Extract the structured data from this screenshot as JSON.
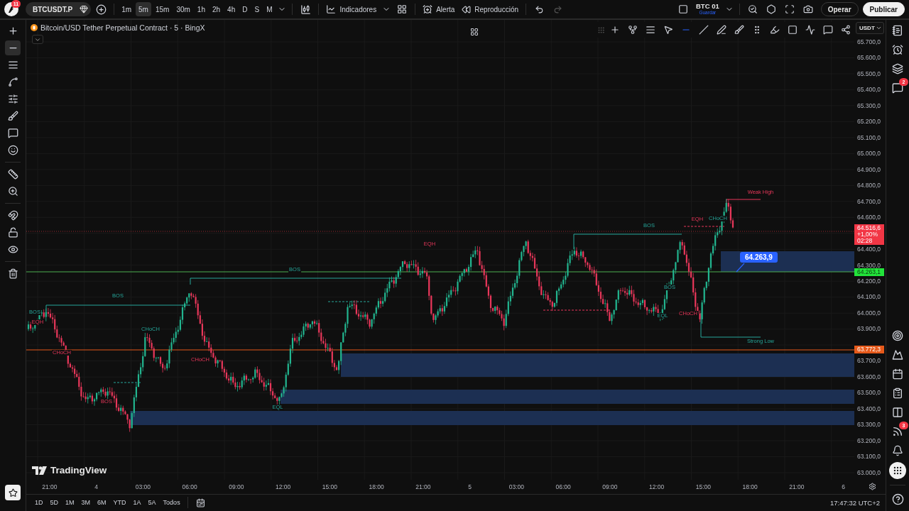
{
  "top_bar": {
    "logo_badge": "11",
    "symbol": "BTCUSDT.P",
    "intervals": [
      {
        "label": "1m",
        "selected": false
      },
      {
        "label": "5m",
        "selected": true
      },
      {
        "label": "15m",
        "selected": false
      },
      {
        "label": "30m",
        "selected": false
      },
      {
        "label": "1h",
        "selected": false
      },
      {
        "label": "2h",
        "selected": false
      },
      {
        "label": "4h",
        "selected": false
      },
      {
        "label": "D",
        "selected": false
      },
      {
        "label": "S",
        "selected": false
      },
      {
        "label": "M",
        "selected": false
      }
    ],
    "indicators": "Indicadores",
    "alert": "Alerta",
    "replay": "Reproducción",
    "layout_name": "BTC 01",
    "layout_status": "Guardar",
    "trade_button": "Operar",
    "publish_button": "Publicar"
  },
  "left_toolbar": [
    {
      "selected": false
    },
    {
      "selected": true
    },
    {
      "selected": false
    },
    {
      "selected": false
    },
    {
      "selected": false
    },
    {
      "selected": false
    },
    {
      "selected": false
    },
    {
      "selected": false
    },
    {
      "selected": false
    },
    {
      "selected": false
    },
    {
      "selected": false
    },
    {
      "selected": false
    },
    {
      "selected": false
    },
    {
      "selected": false
    }
  ],
  "chart": {
    "legend": "Bitcoin/USD Tether Perpetual Contract · 5 · BingX",
    "currency": "USDT",
    "watermark": "TradingView",
    "callout": "64.263,9",
    "price_scale": [
      "65.700,0",
      "65.600,0",
      "65.500,0",
      "65.400,0",
      "65.300,0",
      "65.200,0",
      "65.100,0",
      "65.000,0",
      "64.900,0",
      "64.800,0",
      "64.700,0",
      "64.600,0",
      "64.400,0",
      "64.300,0",
      "64.200,0",
      "64.100,0",
      "64.000,0",
      "63.900,0",
      "63.700,0",
      "63.600,0",
      "63.500,0",
      "63.400,0",
      "63.300,0",
      "63.200,0",
      "63.100,0",
      "63.000,0"
    ],
    "time_scale": [
      "21:00",
      "4",
      "03:00",
      "06:00",
      "09:00",
      "12:00",
      "15:00",
      "18:00",
      "21:00",
      "5",
      "03:00",
      "06:00",
      "09:00",
      "12:00",
      "15:00",
      "18:00",
      "21:00",
      "6"
    ],
    "price_tags": [
      {
        "kind": "last",
        "lines": [
          "64.516,6",
          "+1,00%",
          "02:28"
        ]
      },
      {
        "kind": "level",
        "lines": [
          "64.263,1"
        ]
      },
      {
        "kind": "line",
        "lines": [
          "63.772,3"
        ]
      }
    ],
    "annotations": [
      {
        "text": "BOS",
        "kind": "bull"
      },
      {
        "text": "BOS",
        "kind": "bull"
      },
      {
        "text": "BOS",
        "kind": "bull"
      },
      {
        "text": "Weak High",
        "kind": "bear"
      },
      {
        "text": "Strong Low",
        "kind": "bull"
      },
      {
        "text": "EQH",
        "kind": "bear"
      },
      {
        "text": "CHoCH",
        "kind": "bull"
      },
      {
        "text": "EQH",
        "kind": "bear"
      },
      {
        "text": "EQL",
        "kind": "bull"
      },
      {
        "text": "CHoCH",
        "kind": "bull"
      },
      {
        "text": "CHoCH",
        "kind": "bear"
      },
      {
        "text": "BOS",
        "kind": "bull"
      },
      {
        "text": "EQH",
        "kind": "bear"
      },
      {
        "text": "CHoCH",
        "kind": "bear"
      },
      {
        "text": "BOS",
        "kind": "bear"
      },
      {
        "text": "EQL",
        "kind": "bull"
      },
      {
        "text": "CHoCH",
        "kind": "bear"
      },
      {
        "text": "BOS",
        "kind": "bull"
      }
    ]
  },
  "right_sidebar": {
    "chat_badge": "2",
    "feed_badge": "3"
  },
  "bottom_bar": {
    "ranges": [
      "1D",
      "5D",
      "1M",
      "3M",
      "6M",
      "YTD",
      "1A",
      "5A",
      "Todos"
    ],
    "clock": "17:47:32 UTC+2"
  }
}
